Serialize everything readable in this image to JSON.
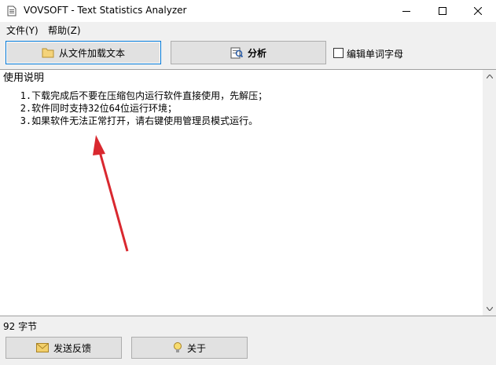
{
  "window": {
    "title": "VOVSOFT - Text Statistics Analyzer",
    "icons": [
      "app-icon",
      "minimize-icon",
      "maximize-icon",
      "close-icon"
    ]
  },
  "menu": {
    "file": "文件(Y)",
    "help": "帮助(Z)"
  },
  "toolbar": {
    "load_label": "从文件加载文本",
    "analyze_label": "分析",
    "edit_words_label": "编辑单词字母",
    "edit_words_checked": false
  },
  "editor": {
    "heading": "使用说明",
    "lines": [
      "1.下载完成后不要在压缩包内运行软件直接使用，先解压；",
      "2.软件同时支持32位64位运行环境；",
      "3.如果软件无法正常打开，请右键使用管理员模式运行。"
    ]
  },
  "status": {
    "char_count": "92 字节"
  },
  "footer": {
    "feedback_label": "发送反馈",
    "about_label": "关于"
  },
  "colors": {
    "focus_border": "#0078d7",
    "annotation_arrow": "#d9282f",
    "button_face": "#e1e1e1"
  }
}
